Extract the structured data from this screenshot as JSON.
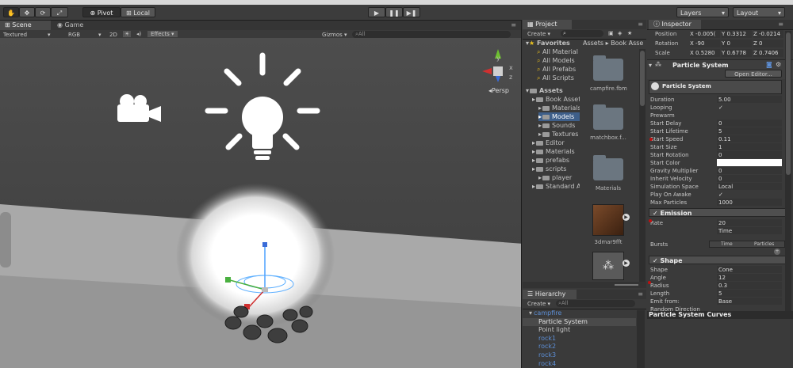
{
  "toolbar": {
    "pivot_label": "Pivot",
    "local_label": "Local",
    "layers_label": "Layers",
    "layout_label": "Layout"
  },
  "scene": {
    "tab_scene": "Scene",
    "tab_game": "Game",
    "shading_mode": "Textured",
    "render_mode": "RGB",
    "mode_2d": "2D",
    "effects_label": "Effects",
    "gizmos_label": "Gizmos",
    "search_placeholder": "All",
    "persp_label": "Persp",
    "gizmo_axes": {
      "y": "y",
      "x": "x",
      "z": "z"
    }
  },
  "project": {
    "tab_label": "Project",
    "create_label": "Create",
    "breadcrumb": [
      "Assets",
      "Book Asse"
    ],
    "favorites_label": "Favorites",
    "favorites": [
      "All Material",
      "All Models",
      "All Prefabs",
      "All Scripts"
    ],
    "tree": [
      {
        "label": "Assets",
        "level": 0,
        "expanded": true,
        "bold": true
      },
      {
        "label": "Book Asset",
        "level": 1
      },
      {
        "label": "Materials",
        "level": 2
      },
      {
        "label": "Models",
        "level": 2,
        "selected": true
      },
      {
        "label": "Sounds",
        "level": 2
      },
      {
        "label": "Textures",
        "level": 2
      },
      {
        "label": "Editor",
        "level": 1
      },
      {
        "label": "Materials",
        "level": 1
      },
      {
        "label": "prefabs",
        "level": 1
      },
      {
        "label": "scripts",
        "level": 1
      },
      {
        "label": "player",
        "level": 2
      },
      {
        "label": "Standard A",
        "level": 1
      }
    ],
    "assets": [
      "campfire.fbm",
      "matchbox.f...",
      "Materials",
      "3dmar9fft",
      ""
    ]
  },
  "hierarchy": {
    "tab_label": "Hierarchy",
    "create_label": "Create",
    "search_placeholder": "All",
    "items": [
      {
        "label": "campfire",
        "level": 0,
        "color": "#5d8fd6"
      },
      {
        "label": "Particle System",
        "level": 1,
        "selected": true,
        "color": "#e2e2e2"
      },
      {
        "label": "Point light",
        "level": 1,
        "color": "#c8c8c8"
      },
      {
        "label": "rock1",
        "level": 1,
        "color": "#5d8fd6"
      },
      {
        "label": "rock2",
        "level": 1,
        "color": "#5d8fd6"
      },
      {
        "label": "rock3",
        "level": 1,
        "color": "#5d8fd6"
      },
      {
        "label": "rock4",
        "level": 1,
        "color": "#5d8fd6"
      }
    ]
  },
  "inspector": {
    "tab_label": "Inspector",
    "transform": [
      {
        "label": "Position",
        "values": [
          "X -0.005(",
          "Y 0.3312",
          "Z -0.0214"
        ]
      },
      {
        "label": "Rotation",
        "values": [
          "X -90",
          "Y 0",
          "Z 0"
        ]
      },
      {
        "label": "Scale",
        "values": [
          "X 0.5280",
          "Y 0.6778",
          "Z 0.7406"
        ]
      }
    ],
    "component_title": "Particle System",
    "open_editor": "Open Editor...",
    "ps_header": "Particle System",
    "main_props": [
      {
        "label": "Duration",
        "value": "5.00"
      },
      {
        "label": "Looping",
        "value": "✓"
      },
      {
        "label": "Prewarm",
        "value": ""
      },
      {
        "label": "Start Delay",
        "value": "0"
      },
      {
        "label": "Start Lifetime",
        "value": "5"
      },
      {
        "label": "Start Speed",
        "value": "0.11"
      },
      {
        "label": "Start Size",
        "value": "1"
      },
      {
        "label": "Start Rotation",
        "value": "0"
      },
      {
        "label": "Start Color",
        "value": ""
      },
      {
        "label": "Gravity Multiplier",
        "value": "0"
      },
      {
        "label": "Inherit Velocity",
        "value": "0"
      },
      {
        "label": "Simulation Space",
        "value": "Local"
      },
      {
        "label": "Play On Awake",
        "value": "✓"
      },
      {
        "label": "Max Particles",
        "value": "1000"
      }
    ],
    "emission_title": "✓ Emission",
    "emission_props": [
      {
        "label": "Rate",
        "value": "20"
      },
      {
        "label": "",
        "value": "Time"
      }
    ],
    "bursts_label": "Bursts",
    "bursts_cols": [
      "Time",
      "Particles"
    ],
    "shape_title": "✓ Shape",
    "shape_props": [
      {
        "label": "Shape",
        "value": "Cone"
      },
      {
        "label": "Angle",
        "value": "12"
      },
      {
        "label": "Radius",
        "value": "0.3"
      },
      {
        "label": "Length",
        "value": "5"
      },
      {
        "label": "Emit from:",
        "value": "Base"
      },
      {
        "label": "Random Direction",
        "value": ""
      }
    ],
    "curves_label": "Particle System Curves"
  }
}
